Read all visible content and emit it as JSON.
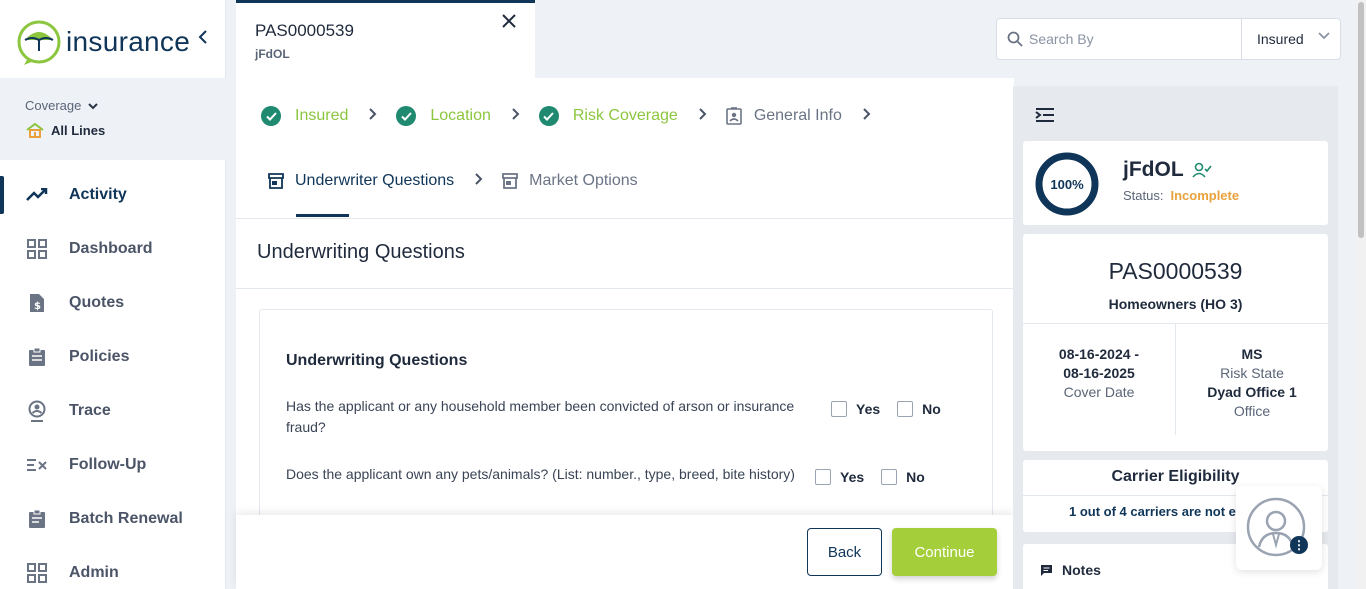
{
  "app": {
    "logo_text": "insurance",
    "collapse_icon": "chevron-left-icon"
  },
  "coverage": {
    "label": "Coverage",
    "value": "All Lines"
  },
  "sidebar": {
    "items": [
      {
        "label": "Activity",
        "icon": "activity-icon",
        "active": true
      },
      {
        "label": "Dashboard",
        "icon": "dashboard-icon"
      },
      {
        "label": "Quotes",
        "icon": "quotes-icon"
      },
      {
        "label": "Policies",
        "icon": "policies-icon"
      },
      {
        "label": "Trace",
        "icon": "trace-icon"
      },
      {
        "label": "Follow-Up",
        "icon": "follow-up-icon"
      },
      {
        "label": "Batch Renewal",
        "icon": "batch-renewal-icon"
      },
      {
        "label": "Admin",
        "icon": "admin-icon"
      }
    ]
  },
  "tab": {
    "id": "PAS0000539",
    "sub": "jFdOL"
  },
  "search": {
    "placeholder": "Search By",
    "select_value": "Insured"
  },
  "steps": [
    {
      "label": "Insured",
      "state": "done"
    },
    {
      "label": "Location",
      "state": "done"
    },
    {
      "label": "Risk Coverage",
      "state": "done"
    },
    {
      "label": "General Info",
      "state": "pending"
    },
    {
      "label": "Underwriter Questions",
      "state": "current"
    },
    {
      "label": "Market Options",
      "state": "pending"
    }
  ],
  "main": {
    "section_title": "Underwriting Questions",
    "card_title": "Underwriting Questions",
    "questions": [
      {
        "text": "Has the applicant or any household member been convicted of arson or insurance fraud?",
        "yes": "Yes",
        "no": "No"
      },
      {
        "text": "Does the applicant own any pets/animals? (List: number., type, breed, bite history)",
        "yes": "Yes",
        "no": "No"
      }
    ]
  },
  "footer": {
    "back": "Back",
    "continue": "Continue"
  },
  "summary": {
    "progress": "100%",
    "progress_value": 1.0,
    "name": "jFdOL",
    "status_label": "Status:",
    "status_value": "Incomplete",
    "policy_number": "PAS0000539",
    "policy_type": "Homeowners (HO 3)",
    "cover_date_line1": "08-16-2024 -",
    "cover_date_line2": "08-16-2025",
    "cover_date_label": "Cover Date",
    "risk_state": "MS",
    "risk_state_label": "Risk State",
    "office": "Dyad Office 1",
    "office_label": "Office",
    "carrier_title": "Carrier Eligibility",
    "carrier_text": "1 out of 4 carriers are not eligible",
    "notes_label": "Notes"
  },
  "colors": {
    "primary": "#0f3558",
    "accent_green": "#8cc63f",
    "check_green": "#1f8a70",
    "status_orange": "#e9a23b"
  }
}
